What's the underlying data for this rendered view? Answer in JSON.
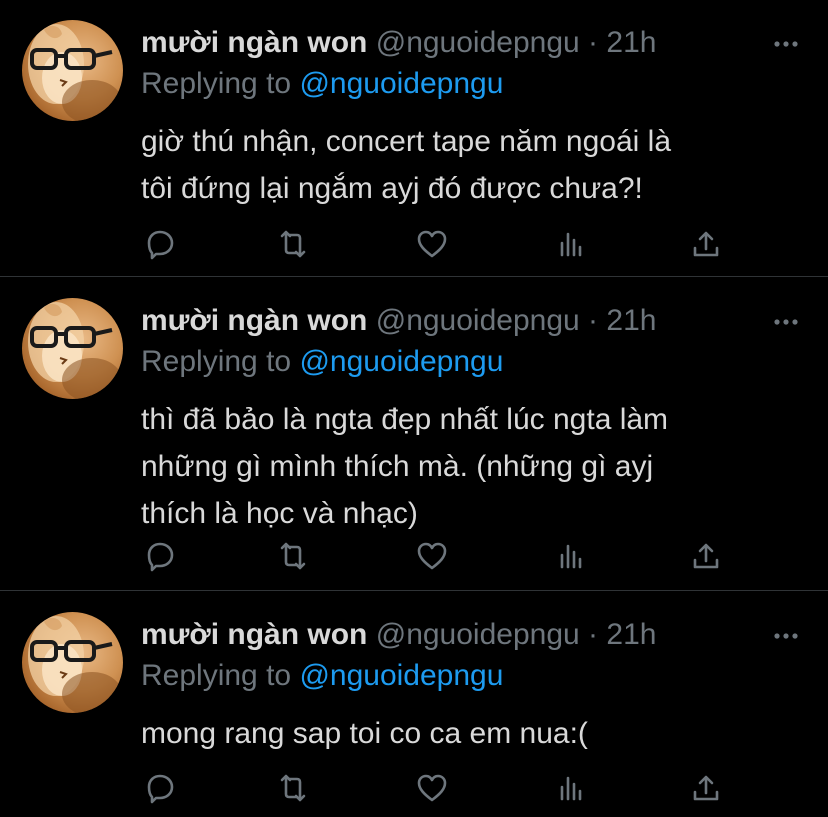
{
  "colors": {
    "background": "#000000",
    "divider": "#2f3336",
    "primary_text": "#d9d9d9",
    "secondary_text": "#6e767d",
    "mention": "#1d9bf0"
  },
  "icons": {
    "more": "more-horizontal-icon",
    "reply": "reply-icon",
    "retweet": "retweet-icon",
    "like": "heart-icon",
    "analytics": "analytics-icon",
    "share": "share-icon"
  },
  "tweets": [
    {
      "name": "mười ngàn won",
      "handle": "@nguoidepngu",
      "separator": "·",
      "time": "21h",
      "reply_prefix": "Replying to",
      "reply_to": "@nguoidepngu",
      "text_lines": [
        "giờ thú nhận, concert tape năm ngoái là",
        "tôi đứng lại ngắm ayj đó được chưa?!"
      ]
    },
    {
      "name": "mười ngàn won",
      "handle": "@nguoidepngu",
      "separator": "·",
      "time": "21h",
      "reply_prefix": "Replying to",
      "reply_to": "@nguoidepngu",
      "text_lines": [
        "thì đã bảo là ngta đẹp nhất lúc ngta làm",
        "những gì mình thích mà. (những gì ayj",
        "thích là học và nhạc)"
      ]
    },
    {
      "name": "mười ngàn won",
      "handle": "@nguoidepngu",
      "separator": "·",
      "time": "21h",
      "reply_prefix": "Replying to",
      "reply_to": "@nguoidepngu",
      "text_lines": [
        "mong rang sap toi co ca em nua:("
      ]
    }
  ]
}
